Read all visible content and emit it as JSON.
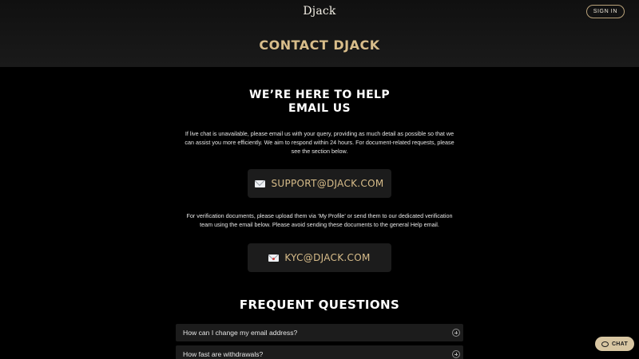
{
  "header": {
    "logo": "Djack",
    "sign_in_label": "SIGN IN",
    "page_title": "CONTACT DJACK"
  },
  "main": {
    "help_title": "WE’RE HERE TO HELP",
    "email_title": "EMAIL US",
    "intro_text": "If live chat is unavailable, please email us with your query, providing as much detail as possible so that we can assist you more efficiently. We aim to respond within 24 hours. For document-related requests, please see the section below.",
    "support_email": "SUPPORT@DJACK.COM",
    "verification_text": "For verification documents, please upload them via ‘My Profile’ or send them to our dedicated verification team using the email below. Please avoid sending these documents to the general Help email.",
    "kyc_email": "KYC@DJACK.COM"
  },
  "faq": {
    "title": "FREQUENT QUESTIONS",
    "items": [
      {
        "question": "How can I change my email address?"
      },
      {
        "question": "How fast are withdrawals?"
      }
    ]
  },
  "chat": {
    "label": "CHAT"
  },
  "colors": {
    "accent_gold": "#d8bd8a",
    "background": "#000000",
    "card": "#1c1c1c",
    "chat_button": "#d8c6a2"
  }
}
